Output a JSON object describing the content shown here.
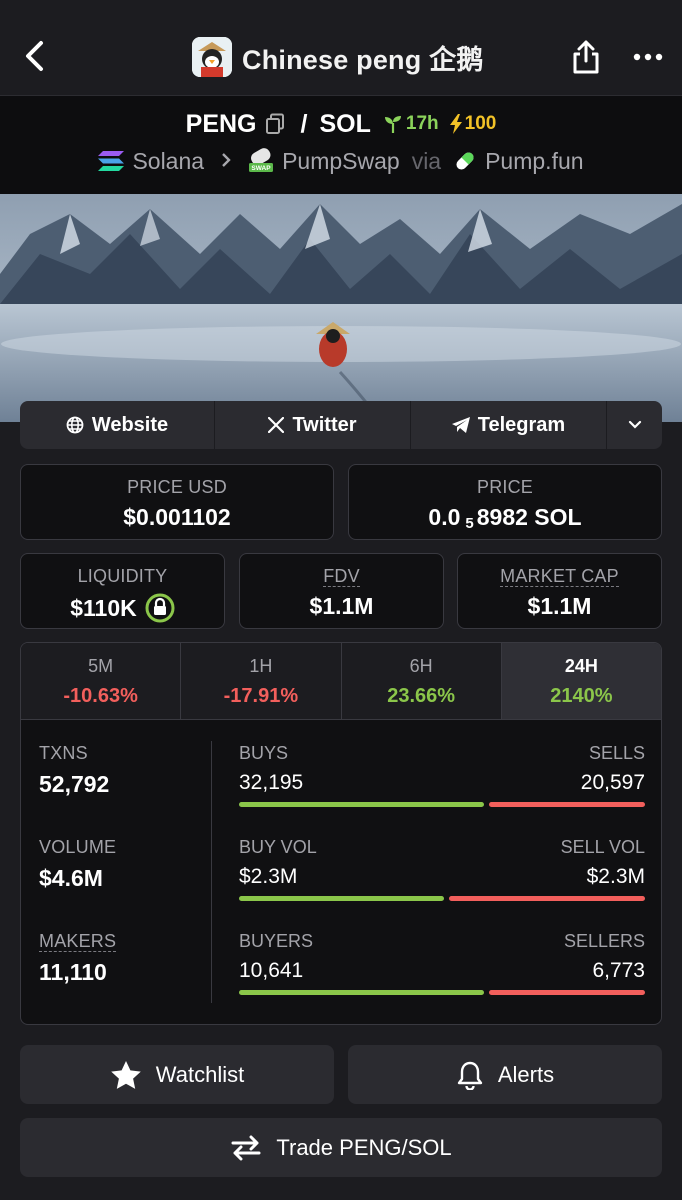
{
  "header": {
    "title": "Chinese peng 企鹅",
    "back_icon": "chevron-left-icon",
    "share_icon": "share-icon",
    "more_icon": "more-horizontal-icon"
  },
  "pair": {
    "base": "PENG",
    "quote": "SOL",
    "age": "17h",
    "boost": "100",
    "chain": "Solana",
    "dex": "PumpSwap",
    "via_label": "via",
    "launchpad": "Pump.fun"
  },
  "links": {
    "website": "Website",
    "twitter": "Twitter",
    "telegram": "Telegram"
  },
  "stats": {
    "price_usd_label": "PRICE USD",
    "price_usd": "$0.001102",
    "price_label": "PRICE",
    "price_prefix": "0.0",
    "price_sub": "5",
    "price_suffix": "8982 SOL",
    "liquidity_label": "LIQUIDITY",
    "liquidity": "$110K",
    "fdv_label": "FDV",
    "fdv": "$1.1M",
    "mcap_label": "MARKET CAP",
    "mcap": "$1.1M"
  },
  "timeframes": [
    {
      "label": "5M",
      "change": "-10.63%"
    },
    {
      "label": "1H",
      "change": "-17.91%"
    },
    {
      "label": "6H",
      "change": "23.66%"
    },
    {
      "label": "24H",
      "change": "2140%"
    }
  ],
  "active_timeframe": "24H",
  "txns": {
    "txns_label": "TXNS",
    "txns": "52,792",
    "volume_label": "VOLUME",
    "volume": "$4.6M",
    "makers_label": "MAKERS",
    "makers": "11,110",
    "buys_label": "BUYS",
    "buys": "32,195",
    "sells_label": "SELLS",
    "sells": "20,597",
    "buys_ratio": 0.61,
    "buy_vol_label": "BUY VOL",
    "buy_vol": "$2.3M",
    "sell_vol_label": "SELL VOL",
    "sell_vol": "$2.3M",
    "buy_vol_ratio": 0.51,
    "buyers_label": "BUYERS",
    "buyers": "10,641",
    "sellers_label": "SELLERS",
    "sellers": "6,773",
    "buyers_ratio": 0.61
  },
  "actions": {
    "watchlist": "Watchlist",
    "alerts": "Alerts",
    "trade": "Trade PENG/SOL"
  },
  "colors": {
    "positive": "#8bc64a",
    "negative": "#f25f5c",
    "boost": "#f2c227",
    "background": "#1c1c20"
  }
}
